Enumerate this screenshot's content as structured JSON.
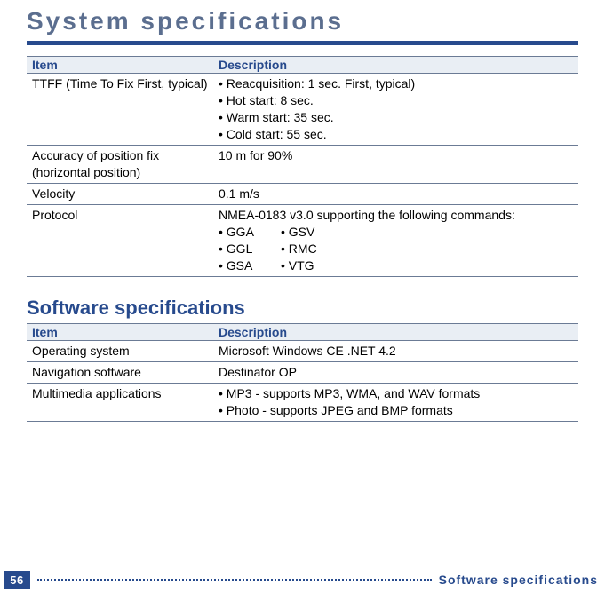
{
  "chapter_title": "System specifications",
  "column_headers": {
    "item": "Item",
    "desc": "Description"
  },
  "table1": {
    "rows": [
      {
        "item": "TTFF (Time To Fix First, typical)",
        "desc_lines": [
          "• Reacquisition: 1 sec. First, typical)",
          "• Hot start: 8 sec.",
          "• Warm start: 35 sec.",
          "• Cold start: 55 sec."
        ]
      },
      {
        "item": "Accuracy of position fix (horizontal position)",
        "desc_lines": [
          "10 m for 90%"
        ]
      },
      {
        "item": "Velocity",
        "desc_lines": [
          "0.1 m/s"
        ]
      },
      {
        "item": "Protocol",
        "desc_intro": "NMEA-0183 v3.0 supporting the following commands:",
        "cmd_pairs": [
          [
            "• GGA",
            "• GSV"
          ],
          [
            "• GGL",
            "• RMC"
          ],
          [
            "• GSA",
            "• VTG"
          ]
        ]
      }
    ]
  },
  "section2_title": "Software specifications",
  "table2": {
    "rows": [
      {
        "item": "Operating system",
        "desc_lines": [
          "Microsoft Windows CE .NET 4.2"
        ]
      },
      {
        "item": "Navigation software",
        "desc_lines": [
          "Destinator OP"
        ]
      },
      {
        "item": "Multimedia applications",
        "desc_lines": [
          "• MP3 - supports MP3, WMA, and WAV formats",
          "• Photo  - supports JPEG and BMP formats"
        ]
      }
    ]
  },
  "footer": {
    "page_number": "56",
    "label": "Software specifications"
  }
}
